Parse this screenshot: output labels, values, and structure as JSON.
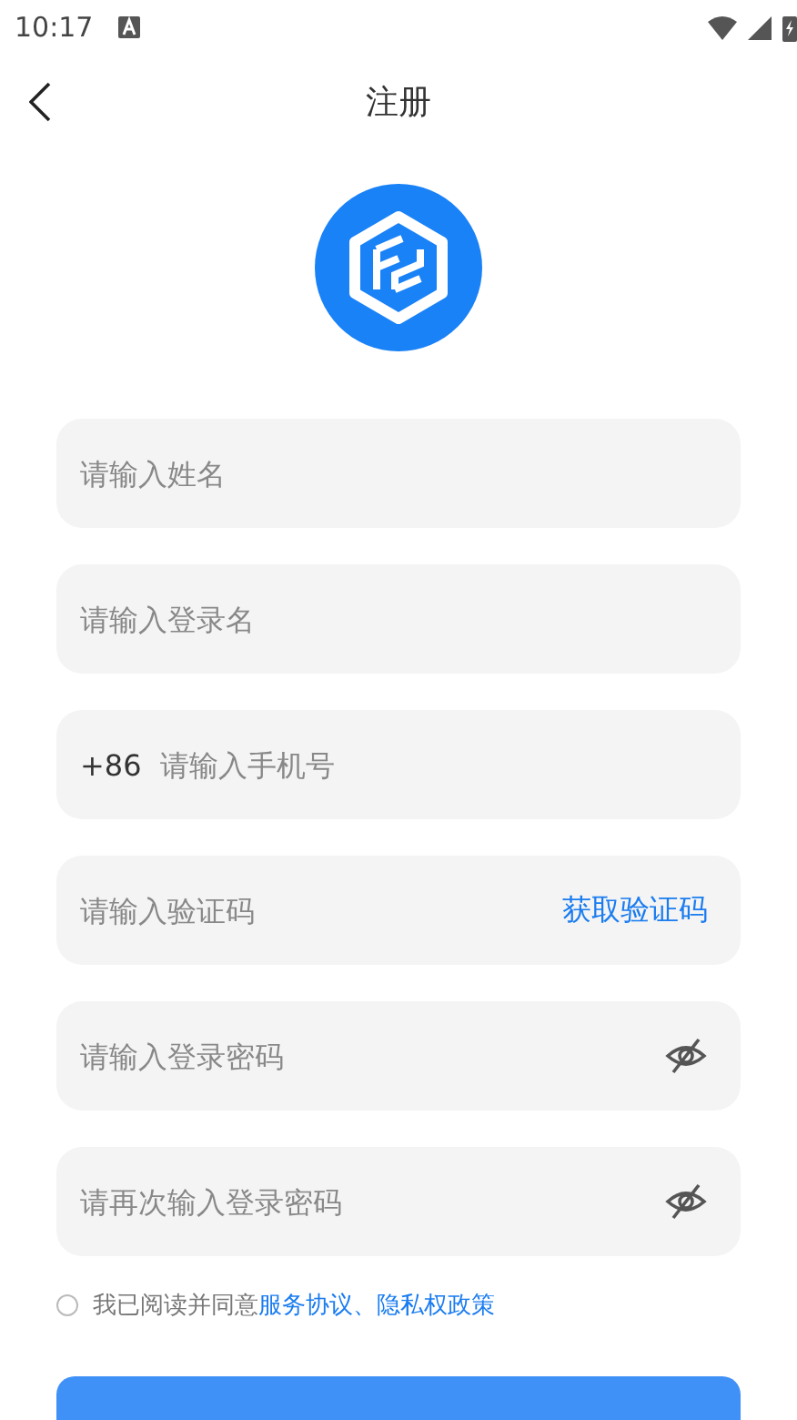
{
  "status_bar": {
    "time": "10:17"
  },
  "header": {
    "title": "注册"
  },
  "fields": [
    {
      "kind": "plain",
      "placeholder": "请输入姓名"
    },
    {
      "kind": "plain",
      "placeholder": "请输入登录名"
    },
    {
      "kind": "phone",
      "prefix": "+86",
      "placeholder": "请输入手机号"
    },
    {
      "kind": "code",
      "placeholder": "请输入验证码",
      "action": "获取验证码"
    },
    {
      "kind": "password",
      "placeholder": "请输入登录密码",
      "visible": false
    },
    {
      "kind": "password",
      "placeholder": "请再次输入登录密码",
      "visible": false
    }
  ],
  "agreement": {
    "checked": false,
    "text": "我已阅读并同意",
    "link": "服务协议、隐私权政策"
  }
}
